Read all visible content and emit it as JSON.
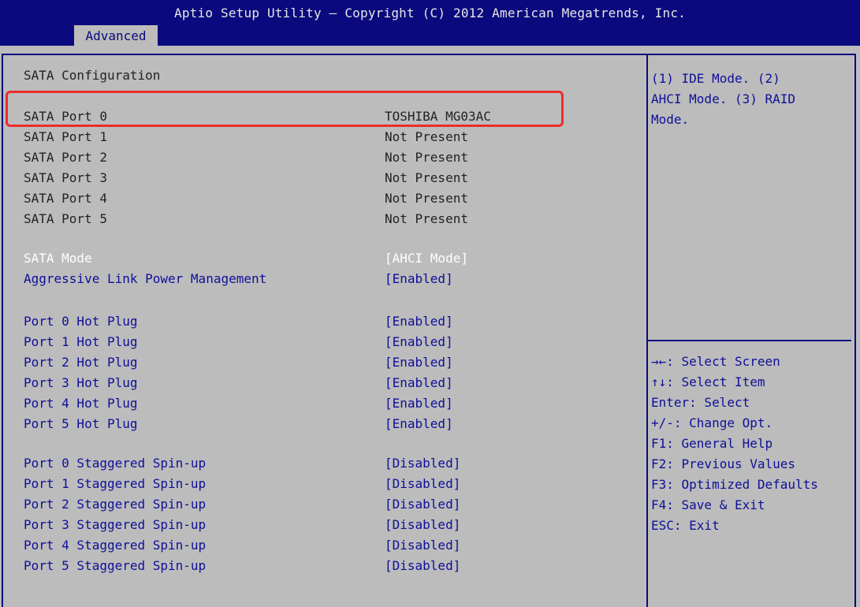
{
  "header": {
    "title": "Aptio Setup Utility – Copyright (C) 2012 American Megatrends, Inc.",
    "active_tab": "Advanced"
  },
  "section_title": "SATA Configuration",
  "ports": [
    {
      "label": "SATA Port 0",
      "value": "TOSHIBA MG03AC"
    },
    {
      "label": "SATA Port 1",
      "value": "Not Present"
    },
    {
      "label": "SATA Port 2",
      "value": "Not Present"
    },
    {
      "label": "SATA Port 3",
      "value": "Not Present"
    },
    {
      "label": "SATA Port 4",
      "value": "Not Present"
    },
    {
      "label": "SATA Port 5",
      "value": "Not Present"
    }
  ],
  "sata_mode": {
    "label": "SATA Mode",
    "value": "[AHCI Mode]"
  },
  "alpm": {
    "label": "Aggressive Link Power Management",
    "value": "[Enabled]"
  },
  "hot_plug": [
    {
      "label": "Port 0 Hot Plug",
      "value": "[Enabled]"
    },
    {
      "label": "Port 1 Hot Plug",
      "value": "[Enabled]"
    },
    {
      "label": "Port 2 Hot Plug",
      "value": "[Enabled]"
    },
    {
      "label": "Port 3 Hot Plug",
      "value": "[Enabled]"
    },
    {
      "label": "Port 4 Hot Plug",
      "value": "[Enabled]"
    },
    {
      "label": "Port 5 Hot Plug",
      "value": "[Enabled]"
    }
  ],
  "spin_up": [
    {
      "label": "Port 0 Staggered Spin-up",
      "value": "[Disabled]"
    },
    {
      "label": "Port 1 Staggered Spin-up",
      "value": "[Disabled]"
    },
    {
      "label": "Port 2 Staggered Spin-up",
      "value": "[Disabled]"
    },
    {
      "label": "Port 3 Staggered Spin-up",
      "value": "[Disabled]"
    },
    {
      "label": "Port 4 Staggered Spin-up",
      "value": "[Disabled]"
    },
    {
      "label": "Port 5 Staggered Spin-up",
      "value": "[Disabled]"
    }
  ],
  "help_text": "(1) IDE Mode. (2)\nAHCI Mode. (3) RAID\nMode.",
  "key_help": [
    "→←: Select Screen",
    "↑↓: Select Item",
    "Enter: Select",
    "+/-: Change Opt.",
    "F1: General Help",
    "F2: Previous Values",
    "F3: Optimized Defaults",
    "F4: Save & Exit",
    "ESC: Exit"
  ],
  "colors": {
    "header_bg": "#0a0a7e",
    "body_bg": "#bcbcbc",
    "selectable_text": "#0f0f99",
    "selected_text": "#ffffff",
    "highlight_border": "#ee2b2b"
  }
}
